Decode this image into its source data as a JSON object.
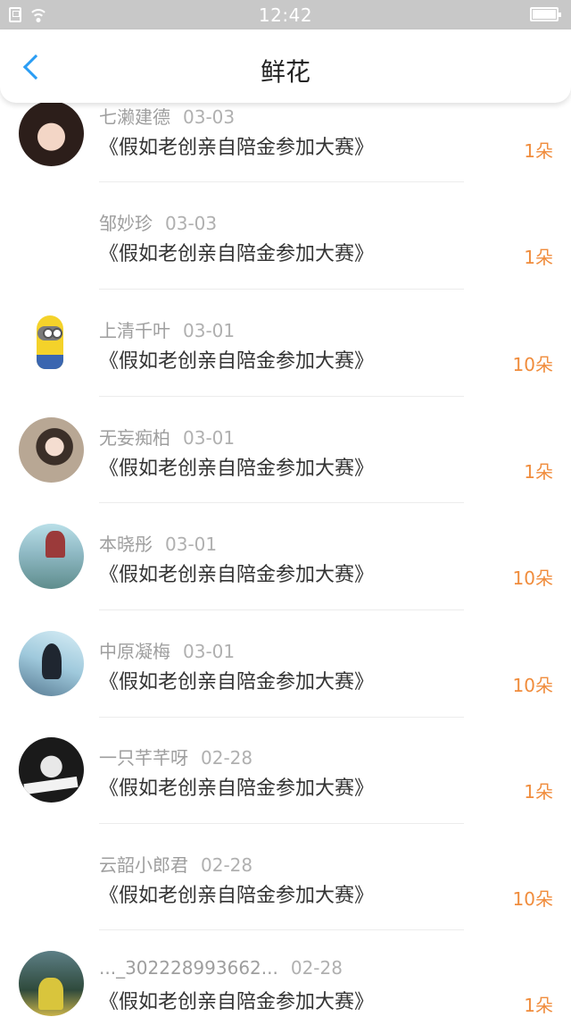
{
  "status_bar": {
    "time": "12:42"
  },
  "header": {
    "title": "鲜花",
    "back_icon": "chevron-left-icon",
    "accent": "#2a9df4"
  },
  "colors": {
    "count": "#f08c3c"
  },
  "items": [
    {
      "name": "七濑建德",
      "date": "03-03",
      "title": "《假如老创亲自陪金参加大赛》",
      "count": "1朵",
      "has_avatar": true
    },
    {
      "name": "邹妙珍",
      "date": "03-03",
      "title": "《假如老创亲自陪金参加大赛》",
      "count": "1朵",
      "has_avatar": false
    },
    {
      "name": "上清千叶",
      "date": "03-01",
      "title": "《假如老创亲自陪金参加大赛》",
      "count": "10朵",
      "has_avatar": true
    },
    {
      "name": "无妄痴柏",
      "date": "03-01",
      "title": "《假如老创亲自陪金参加大赛》",
      "count": "1朵",
      "has_avatar": true
    },
    {
      "name": "本晓彤",
      "date": "03-01",
      "title": "《假如老创亲自陪金参加大赛》",
      "count": "10朵",
      "has_avatar": true
    },
    {
      "name": "中原凝梅",
      "date": "03-01",
      "title": "《假如老创亲自陪金参加大赛》",
      "count": "10朵",
      "has_avatar": true
    },
    {
      "name": "一只芊芊呀",
      "date": "02-28",
      "title": "《假如老创亲自陪金参加大赛》",
      "count": "1朵",
      "has_avatar": true
    },
    {
      "name": "云韶小郎君",
      "date": "02-28",
      "title": "《假如老创亲自陪金参加大赛》",
      "count": "10朵",
      "has_avatar": false
    },
    {
      "name": "..._302228993662...",
      "date": "02-28",
      "title": "《假如老创亲自陪金参加大赛》",
      "count": "1朵",
      "has_avatar": true
    }
  ]
}
